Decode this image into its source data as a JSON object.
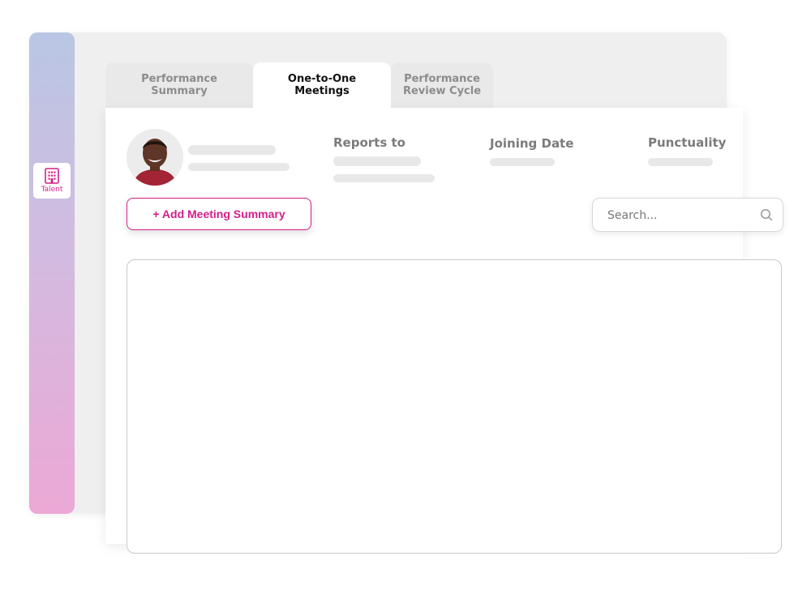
{
  "sidebar": {
    "items": [
      {
        "label": "Talent",
        "icon": "building-icon"
      }
    ],
    "accent": "#d41f8a"
  },
  "tabs": [
    {
      "label": "Performance\nSummary",
      "active": false
    },
    {
      "label": "One-to-One\nMeetings",
      "active": true
    },
    {
      "label": "Performance\nReview Cycle",
      "active": false
    }
  ],
  "profile": {
    "reports_to_label": "Reports to",
    "joining_date_label": "Joining Date",
    "punctuality_label": "Punctuality"
  },
  "actions": {
    "add_meeting_label": "+ Add Meeting Summary"
  },
  "search": {
    "placeholder": "Search..."
  },
  "colors": {
    "accent": "#d41f8a",
    "sidebar_top": "#b9c6e4",
    "sidebar_bottom": "#eca8d6"
  }
}
